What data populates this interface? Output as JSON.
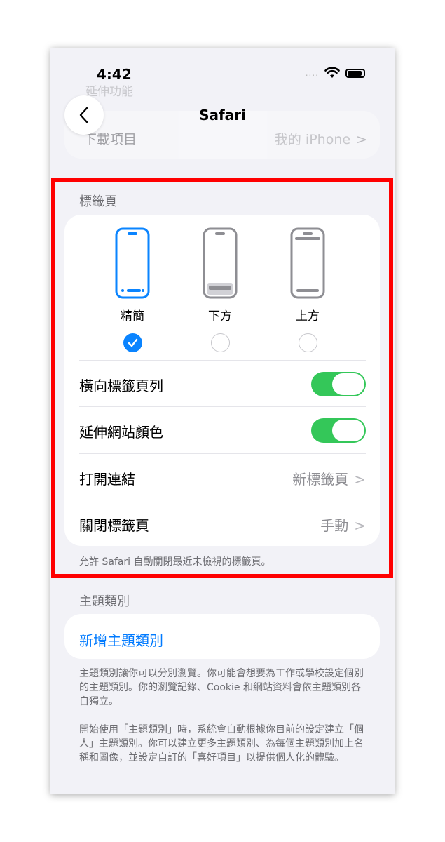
{
  "status_bar": {
    "time": "4:42",
    "signal": "....",
    "wifi_icon": "wifi-icon",
    "battery_icon": "battery-icon"
  },
  "background_hint": "延伸功能",
  "nav": {
    "back_icon": "chevron-left-icon",
    "title": "Safari"
  },
  "downloads": {
    "label": "下載項目",
    "value": "我的 iPhone"
  },
  "tabs_section": {
    "header": "標籤頁",
    "layouts": [
      {
        "label": "精簡",
        "selected": true
      },
      {
        "label": "下方",
        "selected": false
      },
      {
        "label": "上方",
        "selected": false
      }
    ],
    "landscape_tab_bar": {
      "label": "橫向標籤頁列",
      "on": true
    },
    "website_tinting": {
      "label": "延伸網站顏色",
      "on": true
    },
    "open_links": {
      "label": "打開連結",
      "value": "新標籤頁"
    },
    "close_tabs": {
      "label": "關閉標籤頁",
      "value": "手動"
    },
    "footer": "允許 Safari 自動關閉最近未檢視的標籤頁。"
  },
  "profiles_section": {
    "header": "主題類別",
    "new_profile": "新增主題類別",
    "description_1": "主題類別讓你可以分別瀏覽。你可能會想要為工作或學校設定個別的主題類別。你的瀏覽記錄、Cookie 和網站資料會依主題類別各自獨立。",
    "description_2": "開始使用「主題類別」時，系統會自動根據你目前的設定建立「個人」主題類別。你可以建立更多主題類別、為每個主題類別加上名稱和圖像，並設定自訂的「喜好項目」以提供個人化的體驗。"
  },
  "colors": {
    "accent": "#007aff",
    "toggle_on": "#34c759",
    "highlight": "#ff0000",
    "selected_radio": "#0a84ff"
  }
}
